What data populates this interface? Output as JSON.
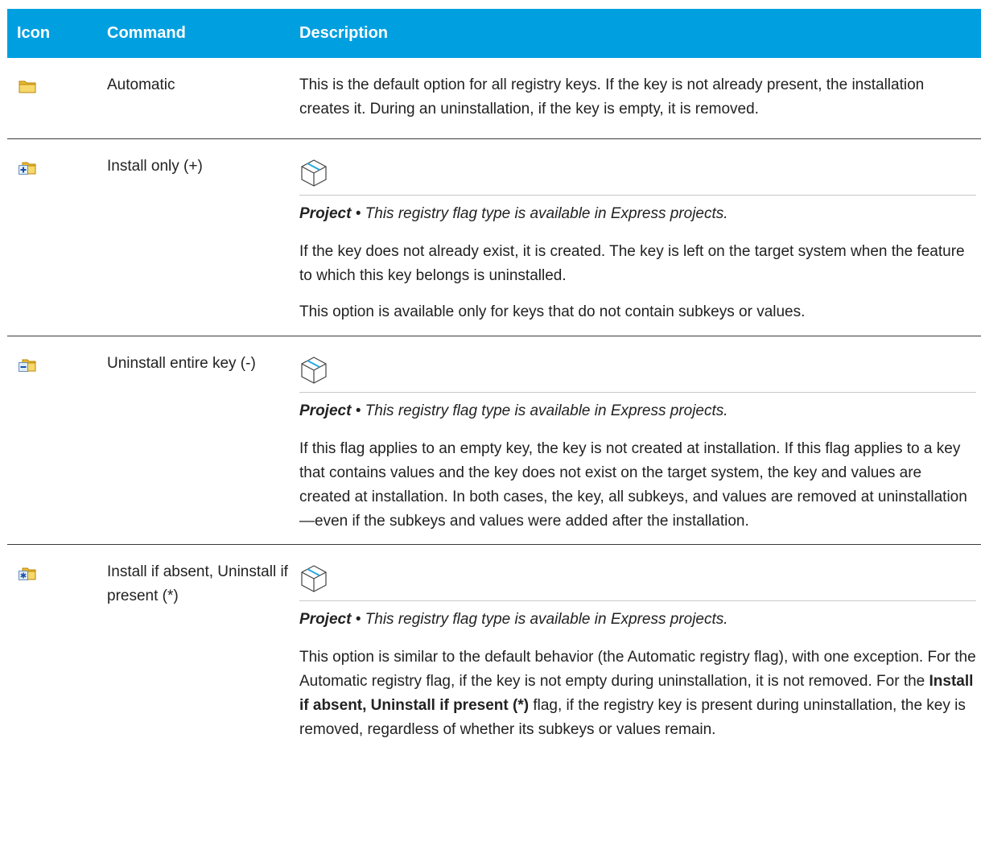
{
  "table": {
    "headers": {
      "icon": "Icon",
      "command": "Command",
      "description": "Description"
    },
    "project_label": "Project",
    "project_bullet": "•",
    "project_text": "This registry flag type is available in Express projects.",
    "rows": [
      {
        "icon": "folder-icon",
        "command": "Automatic",
        "paragraphs": [
          "This is the default option for all registry keys. If the key is not already present, the installation creates it. During an uninstallation, if the key is empty, it is removed."
        ]
      },
      {
        "icon": "folder-plus-icon",
        "command": "Install only (+)",
        "paragraphs": [
          "If the key does not already exist, it is created. The key is left on the target system when the feature to which this key belongs is uninstalled.",
          "This option is available only for keys that do not contain subkeys or values."
        ]
      },
      {
        "icon": "folder-minus-icon",
        "command": "Uninstall entire key (-)",
        "paragraphs": [
          "If this flag applies to an empty key, the key is not created at installation. If this flag applies to a key that contains values and the key does not exist on the target system, the key and values are created at installation. In both cases, the key, all subkeys, and values are removed at uninstallation—even if the subkeys and values were added after the installation."
        ]
      },
      {
        "icon": "folder-asterisk-icon",
        "command": "Install if absent, Uninstall if present (*)",
        "p1": "This option is similar to the default behavior (the Automatic registry flag), with one exception. For the Automatic registry flag, if the key is not empty during uninstallation, it is not removed. For the ",
        "p1_bold": "Install if absent, Uninstall if present (*)",
        "p1_tail": " flag, if the registry key is present during uninstallation, the key is removed, regardless of whether its subkeys or values remain."
      }
    ]
  },
  "colors": {
    "header_bg": "#009fe0",
    "header_text": "#ffffff",
    "row_border": "#3a3a3a"
  }
}
